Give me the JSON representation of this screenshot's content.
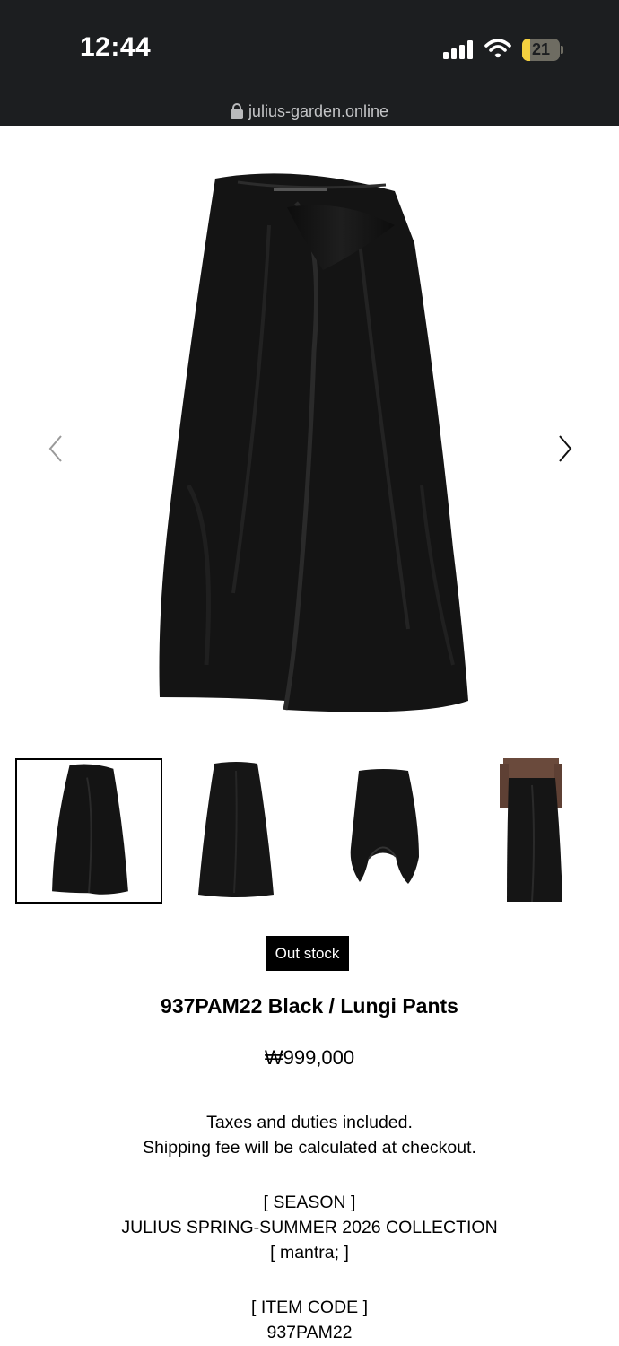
{
  "status": {
    "time": "12:44",
    "battery_level": "21",
    "battery_fraction": 0.21,
    "signal_icon": "signal-bars-icon",
    "wifi_icon": "wifi-icon"
  },
  "browser": {
    "url": "julius-garden.online",
    "lock_icon": "lock-icon"
  },
  "gallery": {
    "prev_icon": "chevron-left-icon",
    "next_icon": "chevron-right-icon",
    "thumbnail_count": 4,
    "selected_index": 0
  },
  "product": {
    "stock_badge": "Out stock",
    "title": "937PAM22 Black / Lungi Pants",
    "price": "₩999,000",
    "tax_note": "Taxes and duties included.",
    "shipping_note": "Shipping fee will be calculated at checkout.",
    "season_heading": "[ SEASON ]",
    "season_name": "JULIUS SPRING-SUMMER 2026 COLLECTION",
    "season_theme": "[ mantra; ]",
    "item_code_heading": "[ ITEM CODE ]",
    "item_code": "937PAM22"
  },
  "colors": {
    "status_bar": "#1c1e20",
    "battery": "#f4d03f",
    "garment": "#141414"
  }
}
